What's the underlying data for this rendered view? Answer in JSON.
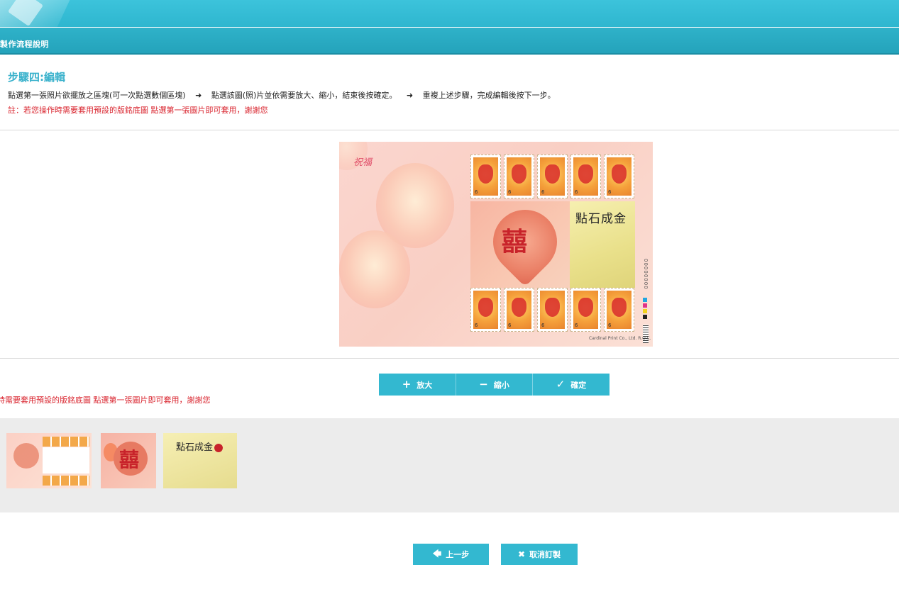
{
  "header": {
    "subtitle": "製作流程說明"
  },
  "step": {
    "title": "步驟四:編輯",
    "instr_1": "點選第一張照片欲擺放之區塊(可一次點選數個區塊)",
    "instr_2": "點選該圖(照)片並依需要放大、縮小，結束後按確定。",
    "instr_3": "重複上述步驟，完成編輯後按下一步。",
    "note": "註：若您操作時需要套用預設的版銘底圖 點選第一張圖片即可套用，謝謝您"
  },
  "sheet": {
    "logo_text": "祝福",
    "calligraphy": "點石成金",
    "heart_char": "囍",
    "serial": "00000000",
    "printer": "Cardinal Print Co., Ltd. R.O.C.",
    "stamp_value": "6"
  },
  "toolbar": {
    "zoom_in_label": "放大",
    "zoom_out_label": "縮小",
    "confirm_label": "確定"
  },
  "note_truncated": "時需要套用預設的版銘底圖 點選第一張圖片即可套用，謝謝您",
  "thumbnails": {
    "thumb3_text": "點石成金"
  },
  "nav": {
    "prev_label": "上一步",
    "cancel_label": "取消訂製"
  },
  "colors": {
    "accent": "#33b8d0",
    "title": "#3bb2cc",
    "note": "#d9232d"
  }
}
